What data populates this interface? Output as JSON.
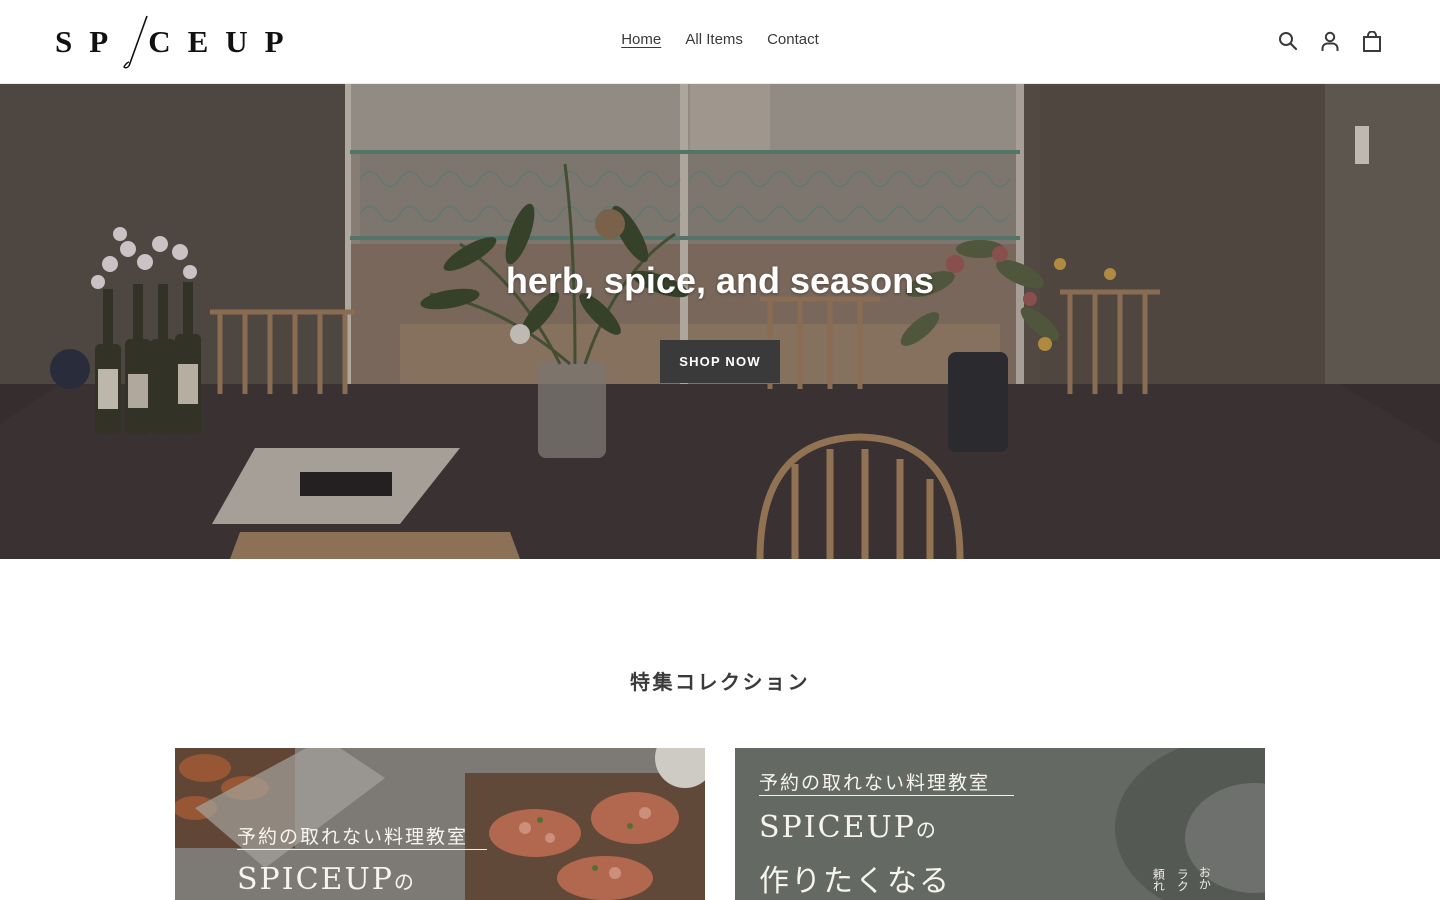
{
  "header": {
    "logo_text": "SP CEUP",
    "nav": [
      {
        "label": "Home",
        "active": true
      },
      {
        "label": "All Items",
        "active": false
      },
      {
        "label": "Contact",
        "active": false
      }
    ],
    "icons": [
      "search-icon",
      "account-icon",
      "cart-icon"
    ]
  },
  "hero": {
    "title": "herb, spice, and seasons",
    "button_label": "SHOP NOW"
  },
  "featured": {
    "title": "特集コレクション",
    "cards": [
      {
        "subtitle": "予約の取れない料理教室",
        "title_main": "SPICEUP",
        "title_particle": "の"
      },
      {
        "subtitle": "予約の取れない料理教室",
        "title_main": "SPICEUP",
        "title_particle": "の",
        "title_line2": "作りたくなる",
        "side_text_1": "おか",
        "side_text_2": "ラク",
        "side_text_3": "頼れ"
      }
    ]
  },
  "colors": {
    "text": "#3a3a3a",
    "button_bg": "#3a3a3a",
    "hero_overlay": "#5b5049"
  }
}
